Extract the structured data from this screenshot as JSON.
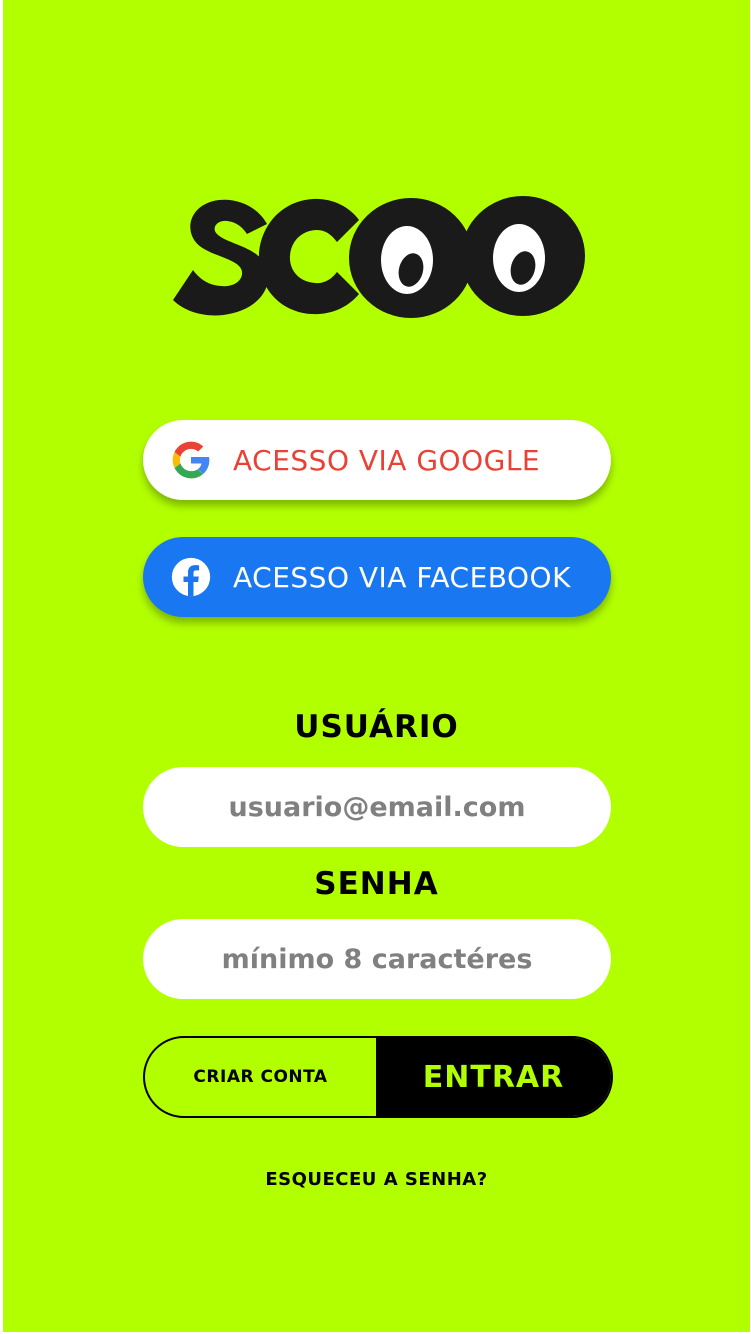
{
  "app": {
    "logo_text": "SCOO"
  },
  "social": {
    "google_label": "ACESSO VIA GOOGLE",
    "google_icon": "google-g-icon",
    "facebook_label": "ACESSO VIA FACEBOOK",
    "facebook_icon": "facebook-f-icon"
  },
  "form": {
    "user_label": "USUÁRIO",
    "user_placeholder": "usuario@email.com",
    "password_label": "SENHA",
    "password_placeholder": "mínimo 8 caractéres"
  },
  "actions": {
    "create_account": "CRIAR CONTA",
    "enter": "ENTRAR",
    "forgot_password": "ESQUECEU A SENHA?"
  },
  "colors": {
    "background": "#b2ff00",
    "google_text": "#e94235",
    "facebook_blue": "#1a77f2",
    "primary_dark": "#000000"
  }
}
